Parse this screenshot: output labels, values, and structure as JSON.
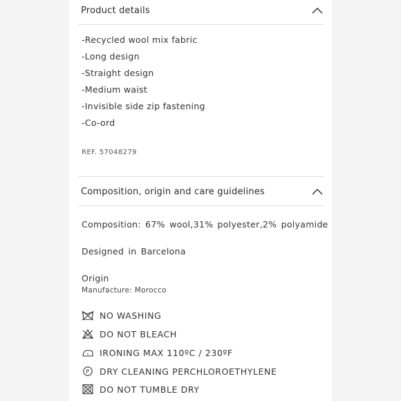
{
  "product_details": {
    "title": "Product details",
    "items": [
      "-Recycled wool mix fabric",
      "-Long design",
      "-Straight design",
      "-Medium waist",
      "-Invisible side zip fastening",
      "-Co-ord"
    ],
    "ref": "REF. 57048279"
  },
  "composition": {
    "title": "Composition, origin and care guidelines",
    "composition_text": "Composition: 67%  wool,31%  polyester,2%  polyamide",
    "designed_in": "Designed in Barcelona",
    "origin_label": "Origin",
    "manufacture": "Manufacture: Morocco"
  },
  "care": [
    {
      "icon": "no-washing-icon",
      "label": "NO WASHING"
    },
    {
      "icon": "do-not-bleach-icon",
      "label": "DO NOT BLEACH"
    },
    {
      "icon": "ironing-icon",
      "label": "IRONING MAX 110ºC / 230ºF"
    },
    {
      "icon": "dry-cleaning-icon",
      "label": "DRY CLEANING PERCHLOROETHYLENE"
    },
    {
      "icon": "do-not-tumble-dry-icon",
      "label": "DO NOT TUMBLE DRY"
    }
  ],
  "colors": {
    "text": "#2b2b2b",
    "divider": "#dcdcdc",
    "background": "#f4f4f4",
    "panel": "#ffffff"
  }
}
